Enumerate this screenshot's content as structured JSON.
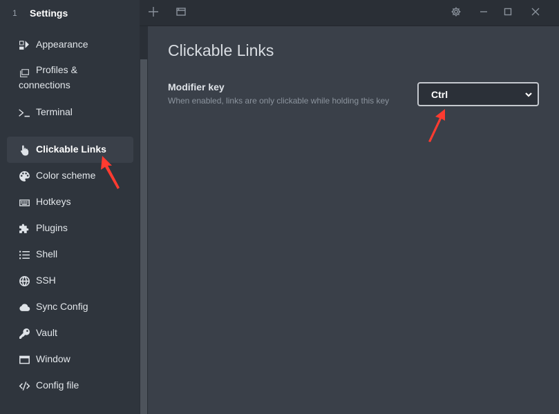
{
  "sidebar": {
    "tab_index": "1",
    "tab_title": "Settings",
    "items": [
      {
        "label": "Appearance",
        "icon": "appearance-icon"
      },
      {
        "label": "Profiles &",
        "label2": "connections",
        "icon": "profiles-icon"
      },
      {
        "label": "Terminal",
        "icon": "terminal-icon"
      },
      {
        "label": "Clickable Links",
        "icon": "pointer-hand-icon",
        "active": true
      },
      {
        "label": "Color scheme",
        "icon": "palette-icon"
      },
      {
        "label": "Hotkeys",
        "icon": "keyboard-icon"
      },
      {
        "label": "Plugins",
        "icon": "puzzle-icon"
      },
      {
        "label": "Shell",
        "icon": "list-icon"
      },
      {
        "label": "SSH",
        "icon": "globe-icon"
      },
      {
        "label": "Sync Config",
        "icon": "cloud-icon"
      },
      {
        "label": "Vault",
        "icon": "key-icon"
      },
      {
        "label": "Window",
        "icon": "window-icon"
      },
      {
        "label": "Config file",
        "icon": "code-icon"
      }
    ]
  },
  "topbar": {
    "new_tab_icon": "plus-icon",
    "tabs_icon": "tab-list-icon",
    "settings_icon": "gear-icon",
    "minimize_icon": "minimize-icon",
    "maximize_icon": "maximize-icon",
    "close_icon": "close-icon"
  },
  "main": {
    "title": "Clickable Links",
    "modifier": {
      "label": "Modifier key",
      "description": "When enabled, links are only clickable while holding this key",
      "value": "Ctrl"
    }
  },
  "colors": {
    "sidebar_bg": "#2f353d",
    "main_bg": "#3a4049",
    "topbar_bg": "#2a2f36",
    "annotation_arrow": "#ff3b30"
  }
}
